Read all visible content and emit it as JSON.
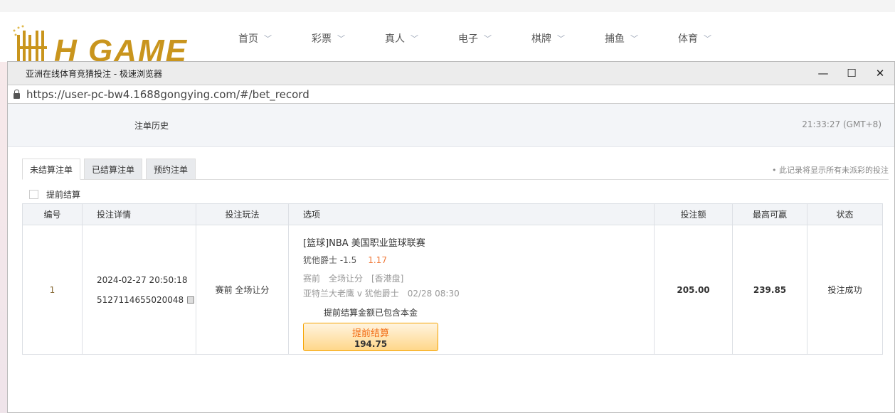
{
  "site": {
    "logo_text": "H GAME",
    "nav": [
      "首页",
      "彩票",
      "真人",
      "电子",
      "棋牌",
      "捕鱼",
      "体育"
    ]
  },
  "window": {
    "title": "亚洲在线体育竞猜投注 - 极速浏览器",
    "url": "https://user-pc-bw4.1688gongying.com/#/bet_record",
    "controls": {
      "minimize": "—",
      "maximize": "☐",
      "close": "✕"
    }
  },
  "page": {
    "title": "注单历史",
    "clock": "21:33:27 (GMT+8)",
    "tabs": [
      "未结算注单",
      "已结算注单",
      "预约注单"
    ],
    "active_tab": 0,
    "note": "• 此记录将显示所有未派彩的投注",
    "early_checkbox": "提前结算",
    "columns": [
      "编号",
      "投注详情",
      "投注玩法",
      "选项",
      "投注额",
      "最高可赢",
      "状态"
    ],
    "rows": [
      {
        "no": "1",
        "datetime": "2024-02-27 20:50:18",
        "order_id": "5127114655020048",
        "play": "赛前 全场让分",
        "league": "[篮球]NBA 美国职业篮球联赛",
        "pick": "犹他爵士 -1.5",
        "odds": "1.17",
        "market": "赛前　全场让分　[香港盘]",
        "match": "亚特兰大老鹰 v 犹他爵士",
        "match_time": "02/28 08:30",
        "included_note": "提前结算金额已包含本金",
        "cashout_label": "提前结算",
        "cashout_amount": "194.75",
        "stake": "205.00",
        "max_win": "239.85",
        "status": "投注成功"
      }
    ]
  }
}
